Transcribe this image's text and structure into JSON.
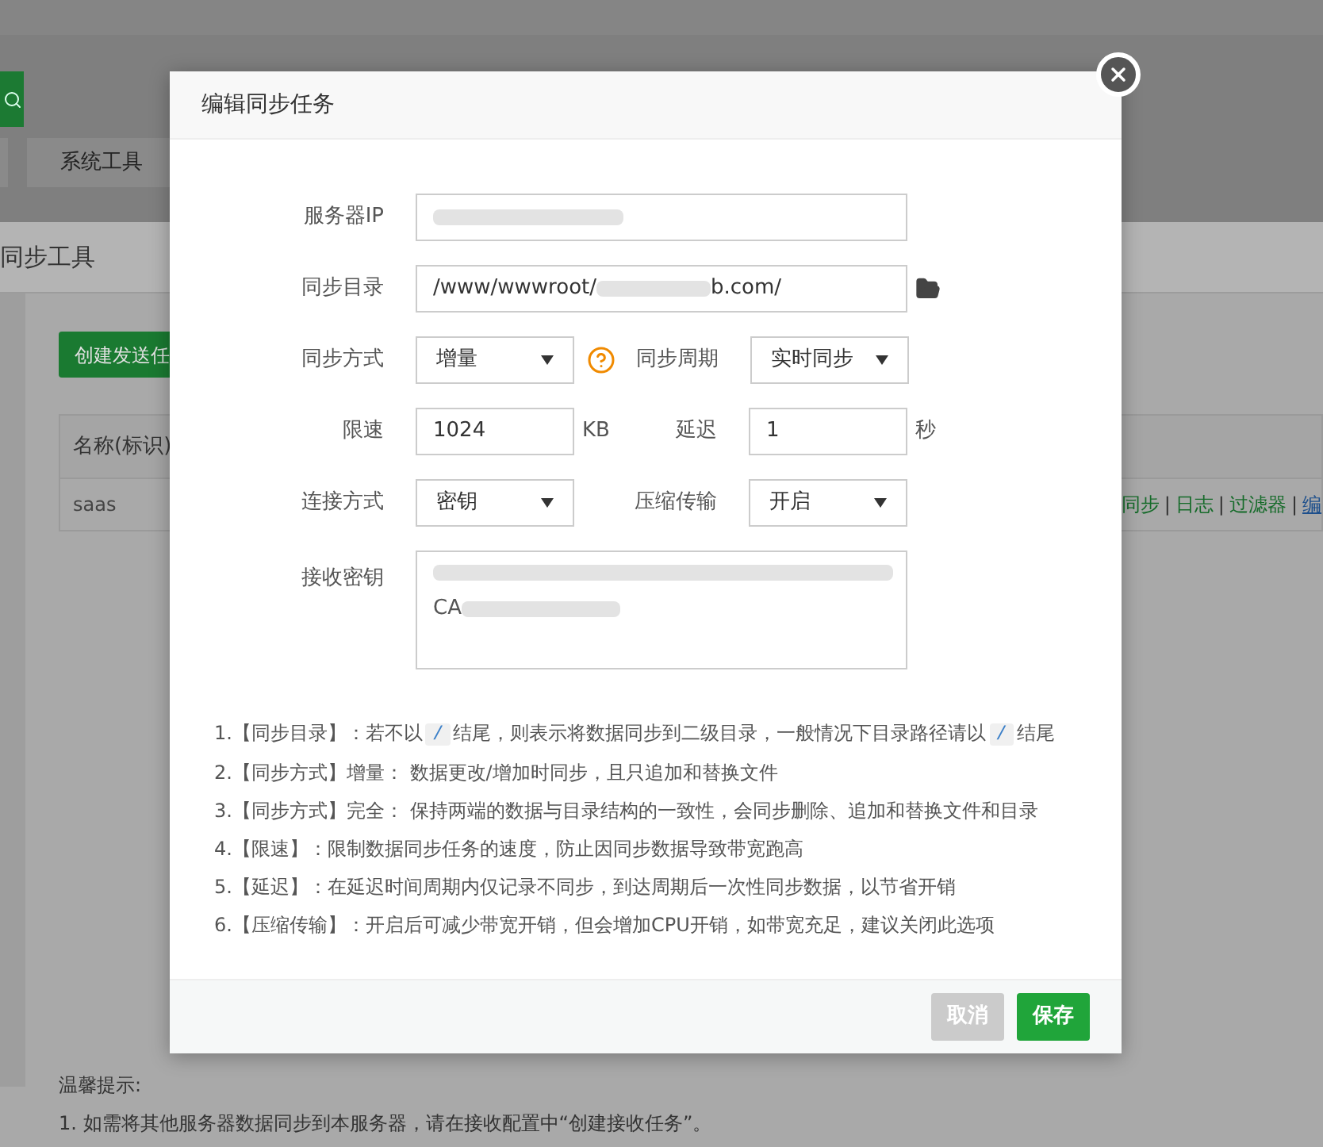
{
  "background": {
    "tabs": [
      {
        "label": "系统工具"
      }
    ],
    "page_title": "同步工具",
    "create_button": "创建发送任",
    "table": {
      "columns": [
        "名称(标识)"
      ],
      "rows": [
        {
          "name": "saas"
        }
      ]
    },
    "row_actions": [
      {
        "label": "同步",
        "kind": "link"
      },
      {
        "label": "|",
        "kind": "separator"
      },
      {
        "label": "日志",
        "kind": "link"
      },
      {
        "label": "|",
        "kind": "separator"
      },
      {
        "label": "过滤器",
        "kind": "link"
      },
      {
        "label": "|",
        "kind": "separator"
      },
      {
        "label": "编",
        "kind": "edit"
      }
    ],
    "tips_title": "温馨提示:",
    "tips": [
      "1. 如需将其他服务器数据同步到本服务器，请在接收配置中“创建接收任务”。"
    ]
  },
  "dialog": {
    "title": "编辑同步任务",
    "server_ip": {
      "label": "服务器IP"
    },
    "sync_dir": {
      "label": "同步目录",
      "value_start": "/www/wwwroot/",
      "value_end": "b.com/"
    },
    "sync_mode": {
      "label": "同步方式",
      "value": "增量"
    },
    "sync_period": {
      "label": "同步周期",
      "value": "实时同步"
    },
    "speed_limit": {
      "label": "限速",
      "value": "1024",
      "unit": "KB"
    },
    "delay": {
      "label": "延迟",
      "value": "1",
      "unit": "秒"
    },
    "connect_mode": {
      "label": "连接方式",
      "value": "密钥"
    },
    "compress": {
      "label": "压缩传输",
      "value": "开启"
    },
    "key": {
      "label": "接收密钥",
      "line2_start": "CA"
    },
    "notes": [
      {
        "parts": [
          {
            "kind": "text",
            "text": "1.【同步目录】：若不以"
          },
          {
            "kind": "code",
            "text": "/"
          },
          {
            "kind": "text",
            "text": "结尾，则表示将数据同步到二级目录，一般情况下目录路径请以"
          },
          {
            "kind": "code",
            "text": "/"
          },
          {
            "kind": "text",
            "text": "结尾"
          }
        ]
      },
      {
        "parts": [
          {
            "kind": "text",
            "text": "2.【同步方式】增量： 数据更改/增加时同步，且只追加和替换文件"
          }
        ]
      },
      {
        "parts": [
          {
            "kind": "text",
            "text": "3.【同步方式】完全： 保持两端的数据与目录结构的一致性，会同步删除、追加和替换文件和目录"
          }
        ]
      },
      {
        "parts": [
          {
            "kind": "text",
            "text": "4.【限速】：限制数据同步任务的速度，防止因同步数据导致带宽跑高"
          }
        ]
      },
      {
        "parts": [
          {
            "kind": "text",
            "text": "5.【延迟】：在延迟时间周期内仅记录不同步，到达周期后一次性同步数据，以节省开销"
          }
        ]
      },
      {
        "parts": [
          {
            "kind": "text",
            "text": "6.【压缩传输】：开启后可减少带宽开销，但会增加CPU开销，如带宽充足，建议关闭此选项"
          }
        ]
      }
    ],
    "buttons": [
      {
        "label": "取消",
        "kind": "cancel"
      },
      {
        "label": "保存",
        "kind": "primary"
      }
    ]
  }
}
